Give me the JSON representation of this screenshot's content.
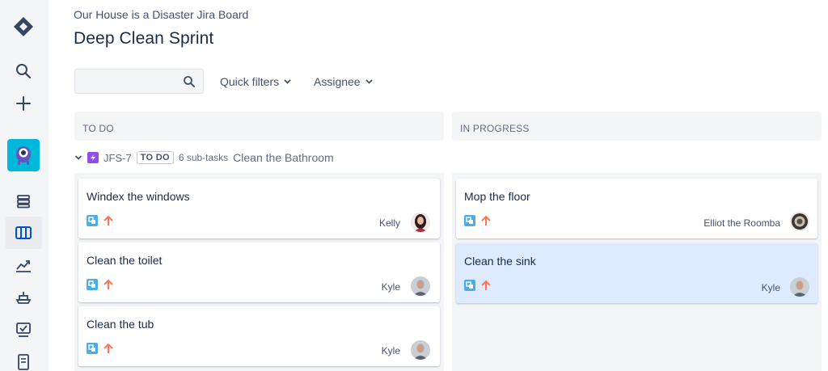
{
  "header": {
    "breadcrumb": "Our House is a Disaster Jira Board",
    "title": "Deep Clean Sprint"
  },
  "toolbar": {
    "search_value": "",
    "filters": [
      "Quick filters",
      "Assignee"
    ]
  },
  "nav": {
    "icons": [
      "jira-logo-icon",
      "search-icon",
      "create-icon",
      "project-avatar",
      "backlog-icon",
      "board-icon",
      "reports-icon",
      "releases-icon",
      "issues-icon",
      "pages-icon"
    ]
  },
  "columns": [
    {
      "name": "TO DO"
    },
    {
      "name": "IN PROGRESS"
    }
  ],
  "swimlane": {
    "key": "JFS-7",
    "status": "TO DO",
    "subtasks": "6 sub-tasks",
    "summary": "Clean the Bathroom"
  },
  "cards": {
    "todo": [
      {
        "summary": "Windex the windows",
        "assignee": "Kelly"
      },
      {
        "summary": "Clean the toilet",
        "assignee": "Kyle"
      },
      {
        "summary": "Clean the tub",
        "assignee": "Kyle"
      }
    ],
    "inprogress": [
      {
        "summary": "Mop the floor",
        "assignee": "Elliot the Roomba"
      },
      {
        "summary": "Clean the sink",
        "assignee": "Kyle"
      }
    ]
  },
  "colors": {
    "accent": "#0052cc",
    "subtask": "#4bade8",
    "priority_high": "#ff7452",
    "selected_card": "#deebff"
  }
}
